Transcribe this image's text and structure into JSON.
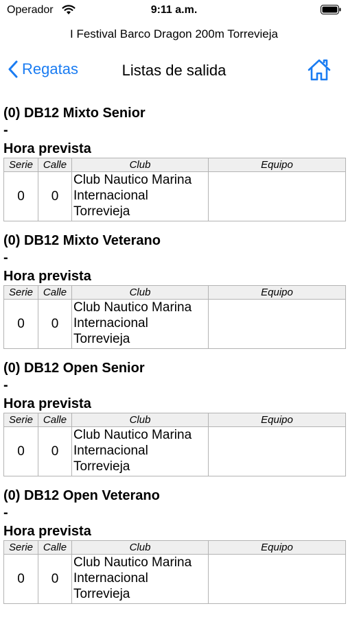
{
  "status": {
    "carrier": "Operador",
    "time": "9:11 a.m."
  },
  "app_title": "I Festival Barco Dragon 200m Torrevieja",
  "nav": {
    "back_label": "Regatas",
    "title": "Listas de salida"
  },
  "accent_color": "#1a7cf2",
  "table_headers": {
    "serie": "Serie",
    "calle": "Calle",
    "club": "Club",
    "equipo": "Equipo"
  },
  "races": [
    {
      "title": "(0) DB12 Mixto Senior",
      "dash": "-",
      "hora": "Hora prevista",
      "row": {
        "serie": "0",
        "calle": "0",
        "club": "Club Nautico Marina Internacional Torrevieja",
        "equipo": ""
      }
    },
    {
      "title": "(0) DB12 Mixto Veterano",
      "dash": "-",
      "hora": "Hora prevista",
      "row": {
        "serie": "0",
        "calle": "0",
        "club": "Club Nautico Marina Internacional Torrevieja",
        "equipo": ""
      }
    },
    {
      "title": "(0) DB12 Open Senior",
      "dash": "-",
      "hora": "Hora prevista",
      "row": {
        "serie": "0",
        "calle": "0",
        "club": "Club Nautico Marina Internacional Torrevieja",
        "equipo": ""
      }
    },
    {
      "title": "(0) DB12 Open Veterano",
      "dash": "-",
      "hora": "Hora prevista",
      "row": {
        "serie": "0",
        "calle": "0",
        "club": "Club Nautico Marina Internacional Torrevieja",
        "equipo": ""
      }
    }
  ]
}
